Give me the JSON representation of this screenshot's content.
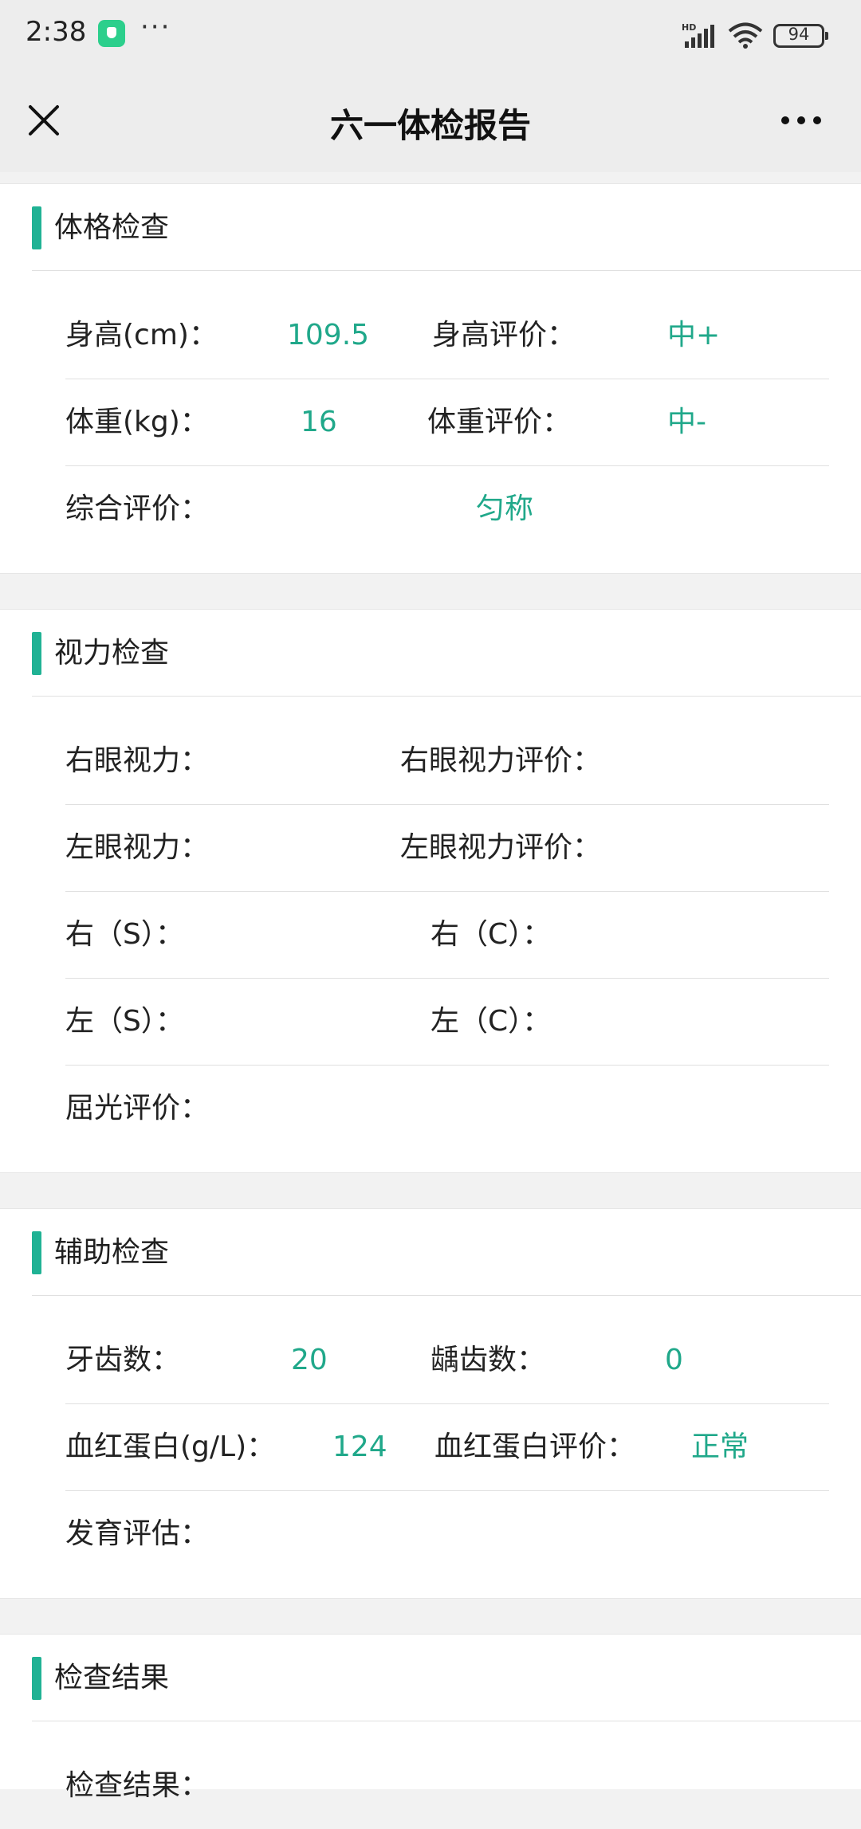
{
  "status_bar": {
    "time": "2:38",
    "battery": "94"
  },
  "nav": {
    "title": "六一体检报告"
  },
  "colors": {
    "accent": "#20b294",
    "value": "#20a88a"
  },
  "sections": {
    "physical": {
      "title": "体格检查",
      "height_label": "身高(cm)：",
      "height_value": "109.5",
      "height_eval_label": "身高评价：",
      "height_eval_value": "中+",
      "weight_label": "体重(kg)：",
      "weight_value": "16",
      "weight_eval_label": "体重评价：",
      "weight_eval_value": "中-",
      "overall_label": "综合评价：",
      "overall_value": "匀称"
    },
    "vision": {
      "title": "视力检查",
      "right_eye_label": "右眼视力：",
      "right_eye_eval_label": "右眼视力评价：",
      "left_eye_label": "左眼视力：",
      "left_eye_eval_label": "左眼视力评价：",
      "right_s_label": "右（S）：",
      "right_c_label": "右（C）：",
      "left_s_label": "左（S）：",
      "left_c_label": "左（C）：",
      "refraction_label": "屈光评价："
    },
    "auxiliary": {
      "title": "辅助检查",
      "teeth_label": "牙齿数：",
      "teeth_value": "20",
      "caries_label": "龋齿数：",
      "caries_value": "0",
      "hemoglobin_label": "血红蛋白(g/L)：",
      "hemoglobin_value": "124",
      "hemoglobin_eval_label": "血红蛋白评价：",
      "hemoglobin_eval_value": "正常",
      "development_label": "发育评估："
    },
    "result": {
      "title": "检查结果",
      "result_label": "检查结果："
    }
  }
}
